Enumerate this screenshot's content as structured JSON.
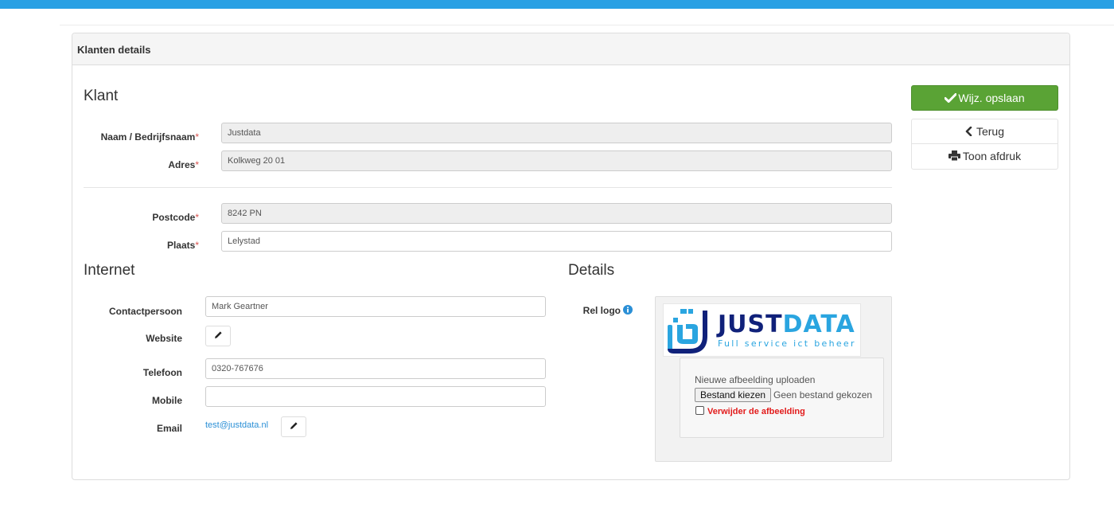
{
  "panel": {
    "title": "Klanten details"
  },
  "klant": {
    "section_title": "Klant",
    "naam_label": "Naam / Bedrijfsnaam",
    "naam_value": "Justdata",
    "adres_label": "Adres",
    "adres_value": "Kolkweg 20 01",
    "postcode_label": "Postcode",
    "postcode_value": "8242 PN",
    "plaats_label": "Plaats",
    "plaats_value": "Lelystad",
    "required_mark": "*"
  },
  "actions": {
    "save_label": "Wijz. opslaan",
    "back_label": "Terug",
    "print_label": "Toon afdruk"
  },
  "internet": {
    "section_title": "Internet",
    "contact_label": "Contactpersoon",
    "contact_value": "Mark Geartner",
    "website_label": "Website",
    "telefoon_label": "Telefoon",
    "telefoon_value": "0320-767676",
    "mobile_label": "Mobile",
    "mobile_value": "",
    "email_label": "Email",
    "email_value": "test@justdata.nl"
  },
  "details": {
    "section_title": "Details",
    "logo_label": "Rel logo",
    "logo_brand_part1": "JUST",
    "logo_brand_part2": "DATA",
    "logo_tagline": "Full service ict beheer",
    "upload_label": "Nieuwe afbeelding uploaden",
    "file_button": "Bestand kiezen",
    "file_status": "Geen bestand gekozen",
    "delete_label": "Verwijder de afbeelding"
  },
  "colors": {
    "topbar": "#29a0e4",
    "success": "#5aa335",
    "required": "#d9534f",
    "danger": "#e21b1b",
    "link": "#2a8fd6",
    "logo_dark": "#10217a",
    "logo_light": "#2aa5e0"
  },
  "icons": {
    "save": "check-icon",
    "back": "chevron-left-icon",
    "print": "print-icon",
    "edit": "pencil-icon",
    "info": "info-circle-icon"
  }
}
